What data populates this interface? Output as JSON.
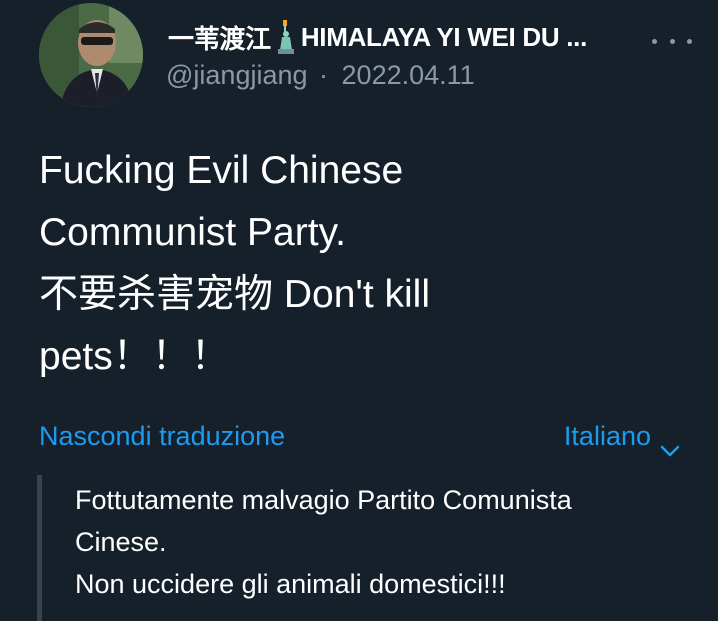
{
  "author": {
    "display_name": "一苇渡江",
    "display_name_suffix": "HIMALAYA YI WEI DU ...",
    "name_icon": "statue-of-liberty-icon",
    "handle": "@jiangjiang",
    "separator": "·",
    "date": "2022.04.11"
  },
  "more_icon": "more-horizontal-icon",
  "tweet": {
    "lines": [
      "Fucking Evil Chinese",
      "Communist Party.",
      "不要杀害宠物 Don't kill",
      "pets！！！"
    ]
  },
  "translation": {
    "hide_label": "Nascondi traduzione",
    "language_label": "Italiano",
    "language_icon": "chevron-down-icon",
    "lines": [
      "Fottutamente malvagio Partito Comunista",
      "Cinese.",
      "Non uccidere gli animali domestici!!!"
    ]
  },
  "colors": {
    "background": "#15202b",
    "text": "#ffffff",
    "secondary_text": "#8b98a5",
    "link": "#1d9bf0",
    "quote_bar": "#38444d"
  }
}
